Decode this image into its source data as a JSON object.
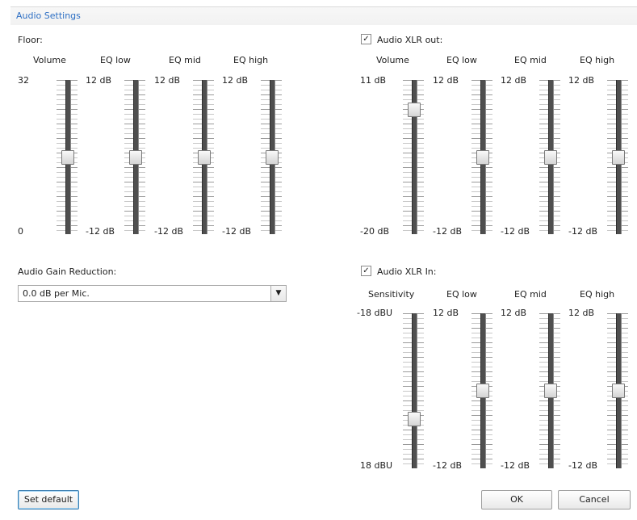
{
  "window": {
    "title": "Audio Settings"
  },
  "floor": {
    "label": "Floor:",
    "headers": [
      "Volume",
      "EQ low",
      "EQ mid",
      "EQ high"
    ],
    "scale": {
      "top": [
        "32",
        "12 dB",
        "12 dB",
        "12 dB"
      ],
      "bottom": [
        "0",
        "-12 dB",
        "-12 dB",
        "-12 dB"
      ]
    },
    "levels": [
      0.5,
      0.5,
      0.5,
      0.5
    ]
  },
  "xlr_out": {
    "label": "Audio XLR out:",
    "checked": true,
    "headers": [
      "Volume",
      "EQ low",
      "EQ mid",
      "EQ high"
    ],
    "scale": {
      "top": [
        "11 dB",
        "12 dB",
        "12 dB",
        "12 dB"
      ],
      "bottom": [
        "-20 dB",
        "-12 dB",
        "-12 dB",
        "-12 dB"
      ]
    },
    "levels": [
      0.84,
      0.5,
      0.5,
      0.5
    ]
  },
  "gain": {
    "label": "Audio Gain Reduction:",
    "value": "0.0 dB per Mic."
  },
  "xlr_in": {
    "label": "Audio XLR In:",
    "checked": true,
    "headers": [
      "Sensitivity",
      "EQ low",
      "EQ mid",
      "EQ high"
    ],
    "scale": {
      "top": [
        "-18 dBU",
        "12 dB",
        "12 dB",
        "12 dB"
      ],
      "bottom": [
        "18 dBU",
        "-12 dB",
        "-12 dB",
        "-12 dB"
      ]
    },
    "levels": [
      0.3,
      0.5,
      0.5,
      0.5
    ]
  },
  "buttons": {
    "set_default": "Set default",
    "ok": "OK",
    "cancel": "Cancel"
  },
  "icons": {
    "check": "checkmark-icon",
    "dropdown": "chevron-down-icon"
  }
}
